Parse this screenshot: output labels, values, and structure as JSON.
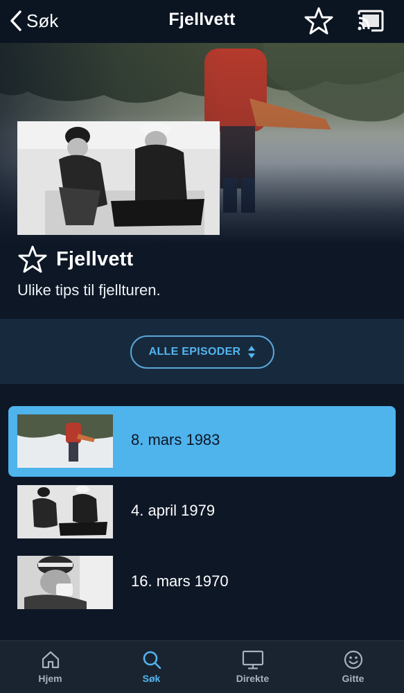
{
  "topbar": {
    "back_label": "Søk",
    "title": "Fjellvett"
  },
  "show": {
    "title": "Fjellvett",
    "description": "Ulike tips til fjellturen."
  },
  "selector": {
    "label": "ALLE EPISODER"
  },
  "episodes": [
    {
      "date": "8. mars 1983",
      "active": true
    },
    {
      "date": "4. april 1979",
      "active": false
    },
    {
      "date": "16. mars 1970",
      "active": false
    }
  ],
  "tabs": [
    {
      "label": "Hjem",
      "icon": "home-icon",
      "active": false
    },
    {
      "label": "Søk",
      "icon": "search-icon",
      "active": true
    },
    {
      "label": "Direkte",
      "icon": "tv-icon",
      "active": false
    },
    {
      "label": "Gitte",
      "icon": "smiley-icon",
      "active": false
    }
  ],
  "colors": {
    "accent": "#4fb3ec",
    "background": "#0d1726",
    "band": "#172a3d",
    "tabbar": "#1a2430"
  }
}
